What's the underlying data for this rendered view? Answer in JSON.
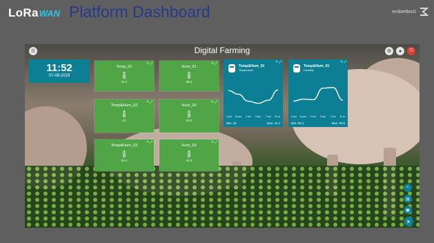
{
  "header": {
    "logo_lora": "LoRa",
    "logo_wan": "WAN",
    "title": "Platform Dashboard",
    "brand": "embedtech"
  },
  "dashboard": {
    "title": "Digital Farming"
  },
  "clock": {
    "time": "11:52",
    "date": "07-08-2019"
  },
  "tiles": [
    {
      "name": "Temp_01",
      "value": "31.4",
      "icon": "thermometer-icon"
    },
    {
      "name": "Hum_01",
      "value": "36.2",
      "icon": "thermometer-icon"
    },
    {
      "name": "Temp&Hum_03",
      "value": "31",
      "icon": "thermometer-icon"
    },
    {
      "name": "Hum_02",
      "value": "40.2",
      "icon": "thermometer-icon"
    },
    {
      "name": "Temp&Hum_03",
      "value": "32.4",
      "icon": "thermometer-icon"
    },
    {
      "name": "Hum_03",
      "value": "41.3",
      "icon": "thermometer-icon"
    }
  ],
  "charts": [
    {
      "title": "Temp&Hum_01",
      "subtitle": "Temperature",
      "min_text": "Min: 25",
      "max_text": "Max: 31.4",
      "chart_data": {
        "type": "line",
        "x": [
          "10 pm",
          "10 pm",
          "2 am",
          "5 am",
          "7 am",
          "11 am"
        ],
        "values": [
          70,
          58,
          35,
          28,
          38,
          72
        ],
        "ylim": [
          0,
          100
        ]
      }
    },
    {
      "title": "Temp&Hum_01",
      "subtitle": "Humidity",
      "min_text": "Min: 56.2",
      "max_text": "Max: 90.5",
      "chart_data": {
        "type": "line",
        "x": [
          "10 pm",
          "10 pm",
          "2 am",
          "5 am",
          "7 am",
          "11 am"
        ],
        "values": [
          35,
          42,
          40,
          78,
          80,
          38
        ],
        "ylim": [
          0,
          100
        ]
      }
    }
  ],
  "colors": {
    "tile_green": "#50a547",
    "card_teal": "#0c7f95",
    "title_blue": "#273a8a"
  }
}
